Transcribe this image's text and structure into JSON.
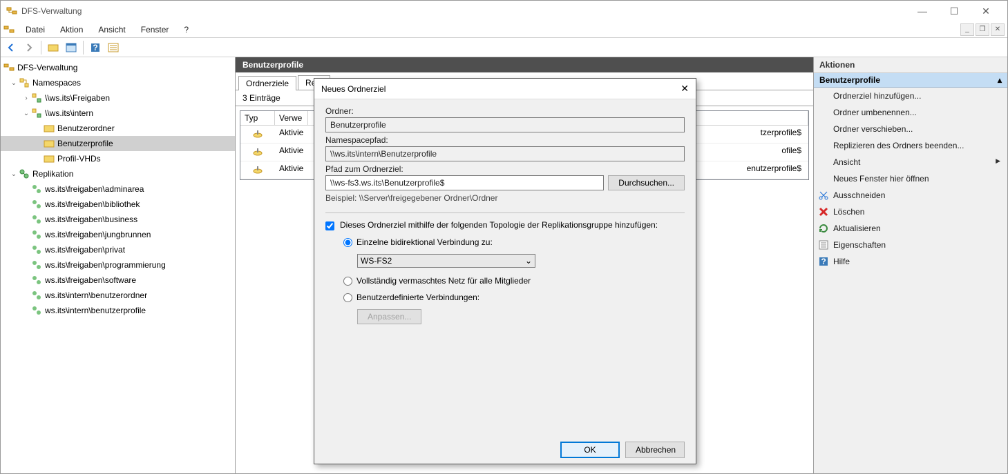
{
  "window": {
    "title": "DFS-Verwaltung"
  },
  "menu": {
    "file": "Datei",
    "action": "Aktion",
    "view": "Ansicht",
    "window": "Fenster",
    "help": "?"
  },
  "tree": {
    "root": "DFS-Verwaltung",
    "namespaces": "Namespaces",
    "ns1": "\\\\ws.its\\Freigaben",
    "ns2": "\\\\ws.its\\intern",
    "ns2_children": {
      "a": "Benutzerordner",
      "b": "Benutzerprofile",
      "c": "Profil-VHDs"
    },
    "replication": "Replikation",
    "rep_items": [
      "ws.its\\freigaben\\adminarea",
      "ws.its\\freigaben\\bibliothek",
      "ws.its\\freigaben\\business",
      "ws.its\\freigaben\\jungbrunnen",
      "ws.its\\freigaben\\privat",
      "ws.its\\freigaben\\programmierung",
      "ws.its\\freigaben\\software",
      "ws.its\\intern\\benutzerordner",
      "ws.its\\intern\\benutzerprofile"
    ]
  },
  "center": {
    "title": "Benutzerprofile",
    "tab1": "Ordnerziele",
    "tab2": "Repl",
    "count": "3 Einträge",
    "col_type": "Typ",
    "col_verw": "Verwe",
    "row_status": "Aktivie",
    "path_suffix": [
      "tzerprofile$",
      "ofile$",
      "enutzerprofile$"
    ]
  },
  "dialog": {
    "title": "Neues Ordnerziel",
    "folder_label": "Ordner:",
    "folder_value": "Benutzerprofile",
    "nspath_label": "Namespacepfad:",
    "nspath_value": "\\\\ws.its\\intern\\Benutzerprofile",
    "target_label": "Pfad zum Ordnerziel:",
    "target_value": "\\\\ws-fs3.ws.its\\Benutzerprofile$",
    "browse": "Durchsuchen...",
    "example": "Beispiel: \\\\Server\\freigegebener Ordner\\Ordner",
    "checkbox": "Dieses Ordnerziel mithilfe der folgenden Topologie der Replikationsgruppe hinzufügen:",
    "radio1": "Einzelne bidirektional Verbindung zu:",
    "select_value": "WS-FS2",
    "radio2": "Vollständig vermaschtes Netz für alle Mitglieder",
    "radio3": "Benutzerdefinierte Verbindungen:",
    "customize": "Anpassen...",
    "ok": "OK",
    "cancel": "Abbrechen"
  },
  "actions": {
    "title": "Aktionen",
    "section": "Benutzerprofile",
    "items": {
      "add_target": "Ordnerziel hinzufügen...",
      "rename": "Ordner umbenennen...",
      "move": "Ordner verschieben...",
      "stop_rep": "Replizieren des Ordners beenden...",
      "view": "Ansicht",
      "new_window": "Neues Fenster hier öffnen",
      "cut": "Ausschneiden",
      "delete": "Löschen",
      "refresh": "Aktualisieren",
      "properties": "Eigenschaften",
      "help": "Hilfe"
    }
  }
}
